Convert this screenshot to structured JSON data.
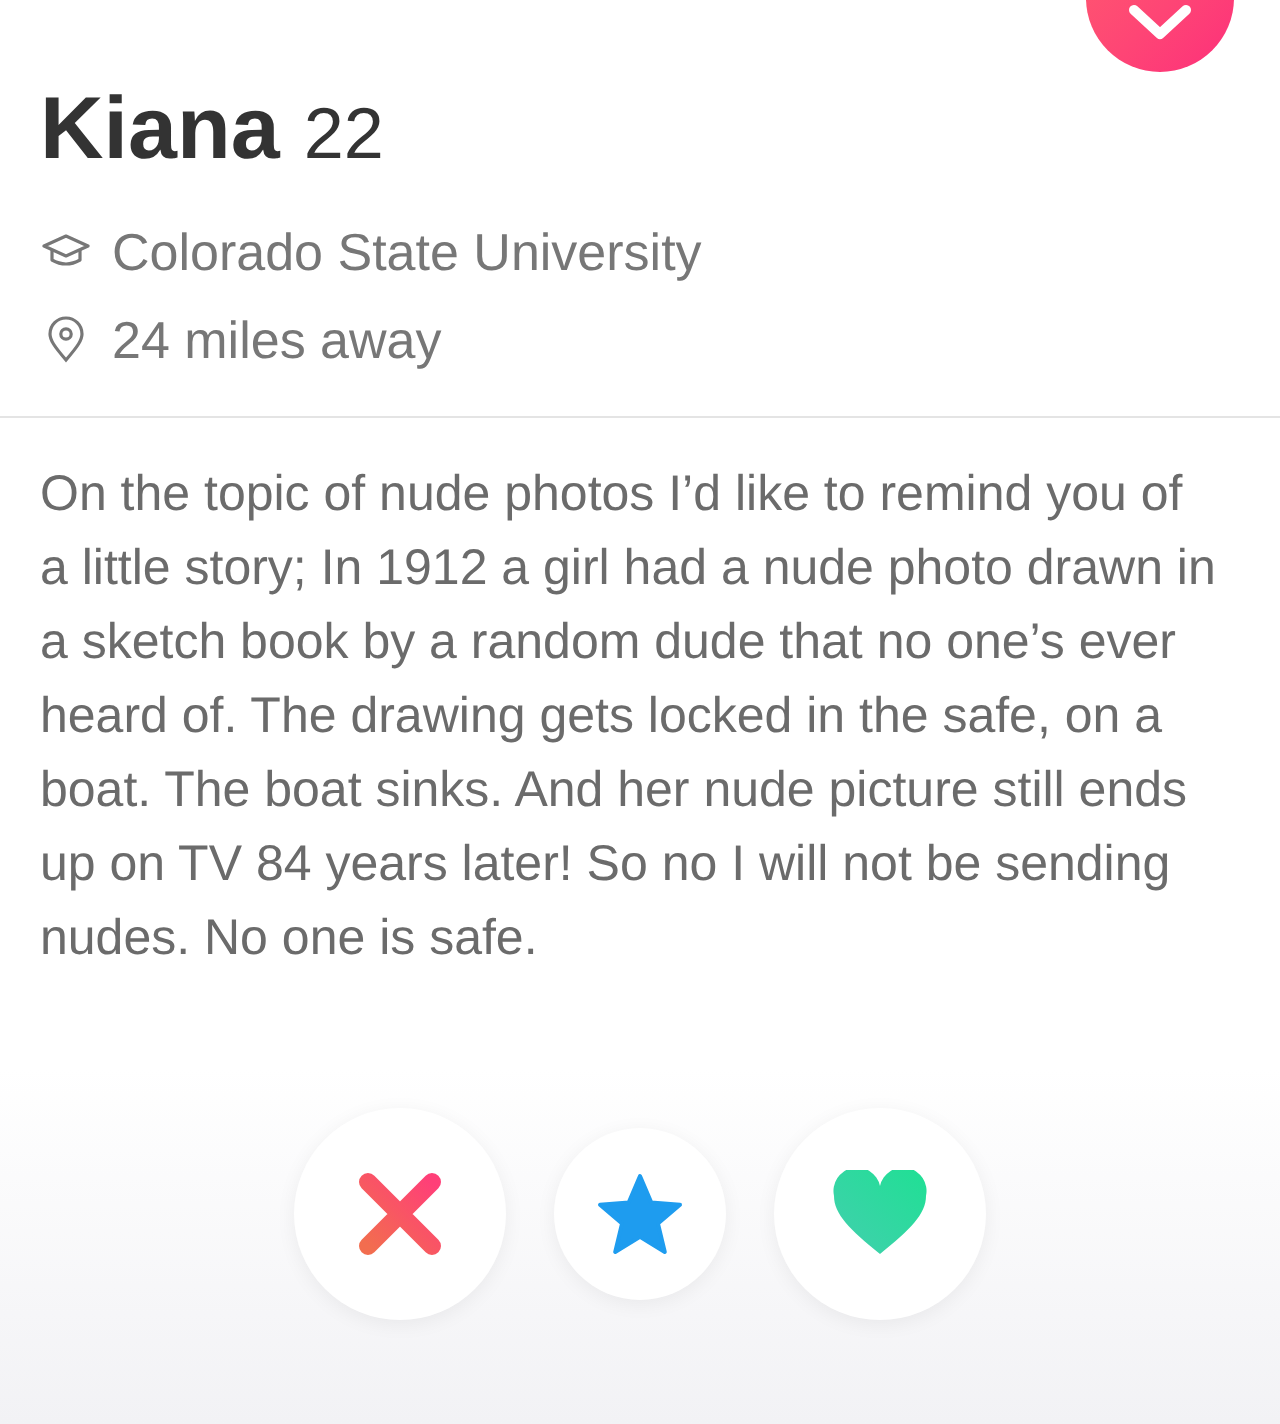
{
  "profile": {
    "name": "Kiana",
    "age": "22",
    "details": [
      {
        "kind": "school",
        "text": "Colorado State University"
      },
      {
        "kind": "distance",
        "text": "24 miles away"
      }
    ]
  },
  "bio": "On the topic of nude photos I’d like to remind you of a little story; In 1912 a girl had a nude photo drawn in a sketch book by a random dude that no one’s ever heard of. The drawing gets locked in the safe, on a boat. The boat sinks. And her nude picture still ends up on TV 84 years later! So no I will not be sending nudes. No one is safe.",
  "actions": [
    {
      "kind": "nope"
    },
    {
      "kind": "super_like"
    },
    {
      "kind": "like"
    }
  ]
}
